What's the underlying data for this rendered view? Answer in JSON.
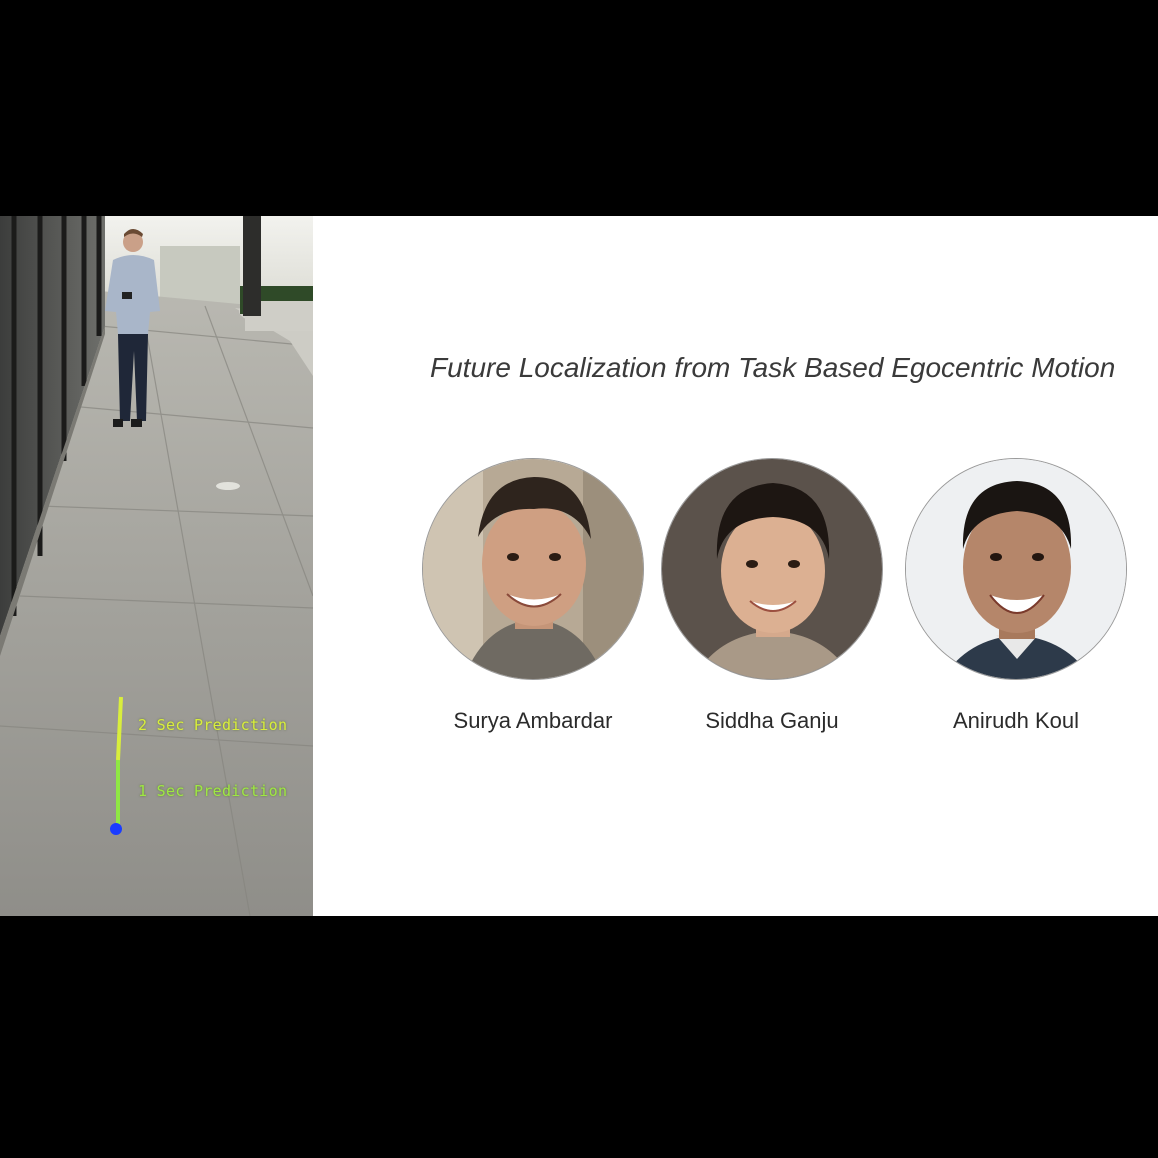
{
  "slide": {
    "title": "Future Localization from Task Based Egocentric Motion"
  },
  "photo": {
    "description_icon": "sidewalk-photo",
    "labels": {
      "two_sec": "2 Sec Prediction",
      "one_sec": "1 Sec Prediction"
    },
    "colors": {
      "two_sec": "#d9ee3c",
      "one_sec": "#9ee843",
      "origin_dot": "#1a3cff"
    }
  },
  "authors": [
    {
      "name": "Surya Ambardar",
      "icon": "portrait-avatar"
    },
    {
      "name": "Siddha Ganju",
      "icon": "portrait-avatar"
    },
    {
      "name": "Anirudh Koul",
      "icon": "portrait-avatar"
    }
  ],
  "colors": {
    "letterbox": "#000000",
    "slide_background": "#ffffff",
    "title_text": "#3a3a3a"
  }
}
